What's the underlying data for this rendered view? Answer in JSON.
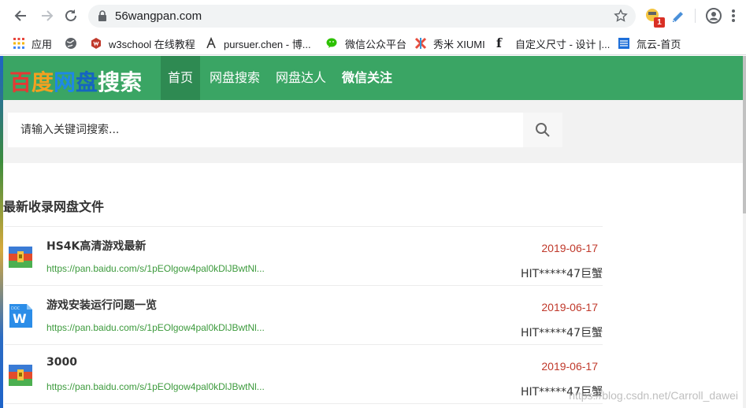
{
  "browser": {
    "url": "56wangpan.com",
    "badge_count": "1"
  },
  "bookmarks": [
    {
      "label": "应用",
      "icon": "apps-icon"
    },
    {
      "label": "",
      "icon": "globe-icon"
    },
    {
      "label": "w3school 在线教程",
      "icon": "w3school-icon"
    },
    {
      "label": "pursuer.chen - 博...",
      "icon": "pursuer-icon"
    },
    {
      "label": "微信公众平台",
      "icon": "wechat-icon"
    },
    {
      "label": "秀米 XIUMI",
      "icon": "xiumi-icon"
    },
    {
      "label": "自定义尺寸 - 设计 |...",
      "icon": "f-icon"
    },
    {
      "label": "氚云-首页",
      "icon": "chuanyun-icon"
    }
  ],
  "site": {
    "logo": [
      "百",
      "度",
      "网",
      "盘",
      "搜",
      "索"
    ],
    "logo_colors": [
      "#e53935",
      "#f4a020",
      "#1e88e5",
      "#1565c0",
      "#ffffff",
      "#ffffff"
    ],
    "nav": [
      "首页",
      "网盘搜索",
      "网盘达人",
      "微信关注"
    ],
    "accent": "#3aa564"
  },
  "search": {
    "placeholder": "请输入关键词搜索..."
  },
  "section_title": "最新收录网盘文件",
  "files": [
    {
      "name": "HS4K高清游戏最新",
      "link": "https://pan.baidu.com/s/1pEOlgow4pal0kDlJBwtNl...",
      "date": "2019-06-17",
      "user": "HIT*****47巨蟹",
      "icon": "archive-icon"
    },
    {
      "name": "游戏安装运行问题一览",
      "link": "https://pan.baidu.com/s/1pEOlgow4pal0kDlJBwtNl...",
      "date": "2019-06-17",
      "user": "HIT*****47巨蟹",
      "icon": "word-doc-icon"
    },
    {
      "name": "3000",
      "link": "https://pan.baidu.com/s/1pEOlgow4pal0kDlJBwtNl...",
      "date": "2019-06-17",
      "user": "HIT*****47巨蟹",
      "icon": "archive-icon"
    }
  ],
  "watermark": "https://blog.csdn.net/Carroll_dawei"
}
